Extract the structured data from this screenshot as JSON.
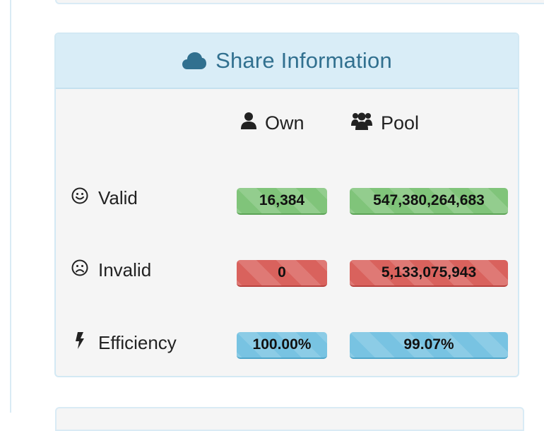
{
  "panel": {
    "title": "Share Information",
    "icon": "cloud-icon",
    "accent_color": "#31708f",
    "heading_bg": "#d9edf7"
  },
  "columns": {
    "own": {
      "label": "Own",
      "icon": "user-icon"
    },
    "pool": {
      "label": "Pool",
      "icon": "users-icon"
    }
  },
  "rows": [
    {
      "key": "valid",
      "label": "Valid",
      "icon": "smile-icon",
      "own": "16,384",
      "pool": "547,380,264,683",
      "status": "success",
      "color": "#80c47a"
    },
    {
      "key": "invalid",
      "label": "Invalid",
      "icon": "frown-icon",
      "own": "0",
      "pool": "5,133,075,943",
      "status": "danger",
      "color": "#d9625d"
    },
    {
      "key": "efficiency",
      "label": "Efficiency",
      "icon": "bolt-icon",
      "own": "100.00%",
      "pool": "99.07%",
      "status": "info",
      "color": "#78c3e2"
    }
  ]
}
